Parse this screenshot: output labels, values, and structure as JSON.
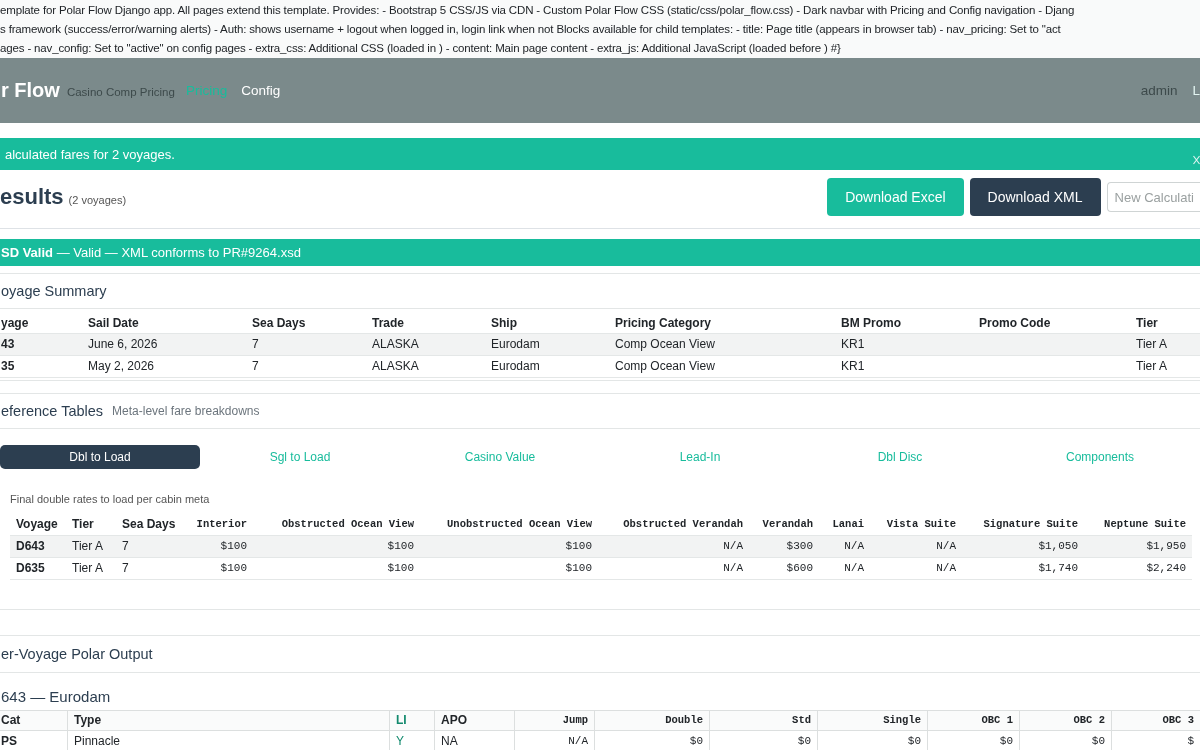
{
  "template_comment": {
    "lines": [
      "emplate for Polar Flow Django app. All pages extend this template. Provides: - Bootstrap 5 CSS/JS via CDN - Custom Polar Flow CSS (static/css/polar_flow.css) - Dark navbar with Pricing and Config navigation - Djang",
      "s framework (success/error/warning alerts) - Auth: shows username + logout when logged in, login link when not Blocks available for child templates: - title: Page title (appears in browser tab) - nav_pricing: Set to \"act",
      "ages - nav_config: Set to \"active\" on config pages - extra_css: Additional CSS (loaded in ) - content: Main page content - extra_js: Additional JavaScript (loaded before ) #}"
    ]
  },
  "navbar": {
    "brand": "r Flow",
    "subtitle": "Casino Comp Pricing",
    "links": [
      {
        "label": "Pricing",
        "selected": true
      },
      {
        "label": "Config",
        "selected": false
      }
    ],
    "user": "admin",
    "logout": "L"
  },
  "alert": {
    "message": "alculated fares for 2 voyages.",
    "dismissible": true
  },
  "results": {
    "title": "esults",
    "count": "(2 voyages)",
    "buttons": [
      {
        "label": "Download Excel",
        "kind": "success"
      },
      {
        "label": "Download XML",
        "kind": "primary"
      },
      {
        "label": "New Calculati",
        "kind": "outline"
      }
    ]
  },
  "validation": {
    "message": "**SD Valid** — Valid — XML conforms to PR#9264.xsd"
  },
  "voyage_summary": {
    "title": "oyage Summary",
    "columns": [
      {
        "label": "yage",
        "kind": "key"
      },
      {
        "label": "Sail Date",
        "kind": "text"
      },
      {
        "label": "Sea Days",
        "kind": "text"
      },
      {
        "label": "Trade",
        "kind": "text"
      },
      {
        "label": "Ship",
        "kind": "text"
      },
      {
        "label": "Pricing Category",
        "kind": "text"
      },
      {
        "label": "BM Promo",
        "kind": "text"
      },
      {
        "label": "Promo Code",
        "kind": "text"
      },
      {
        "label": "Tier",
        "kind": "text"
      }
    ],
    "rows": [
      [
        "43",
        "June 6, 2026",
        "7",
        "ALASKA",
        "Eurodam",
        "Comp Ocean View",
        "KR1",
        null,
        "Tier A"
      ],
      [
        "35",
        "May 2, 2026",
        "7",
        "ALASKA",
        "Eurodam",
        "Comp Ocean View",
        "KR1",
        null,
        "Tier A"
      ]
    ]
  },
  "reference_tables": {
    "title": "eference Tables",
    "subtitle": "Meta-level fare breakdowns",
    "tabs": [
      {
        "label": "Dbl to Load",
        "selected": true
      },
      {
        "label": "Sgl to Load",
        "selected": false
      },
      {
        "label": "Casino Value",
        "selected": false
      },
      {
        "label": "Lead-In",
        "selected": false
      },
      {
        "label": "Dbl Disc",
        "selected": false
      },
      {
        "label": "Components",
        "selected": false
      }
    ],
    "caption": "Final double rates to load per cabin meta",
    "columns": [
      {
        "label": "Voyage",
        "kind": "key"
      },
      {
        "label": "Tier",
        "kind": "text"
      },
      {
        "label": "Sea Days",
        "kind": "text"
      },
      {
        "label": "Interior",
        "kind": "number"
      },
      {
        "label": "Obstructed Ocean View",
        "kind": "number"
      },
      {
        "label": "Unobstructed Ocean View",
        "kind": "number"
      },
      {
        "label": "Obstructed Verandah",
        "kind": "number"
      },
      {
        "label": "Verandah",
        "kind": "number"
      },
      {
        "label": "Lanai",
        "kind": "number"
      },
      {
        "label": "Vista Suite",
        "kind": "number"
      },
      {
        "label": "Signature Suite",
        "kind": "number"
      },
      {
        "label": "Neptune Suite",
        "kind": "number"
      }
    ],
    "rows": [
      [
        "D643",
        "Tier A",
        "7",
        "$100",
        "$100",
        "$100",
        "N/A",
        "$300",
        "N/A",
        "N/A",
        "$1,050",
        "$1,950"
      ],
      [
        "D635",
        "Tier A",
        "7",
        "$100",
        "$100",
        "$100",
        "N/A",
        "$600",
        "N/A",
        "N/A",
        "$1,740",
        "$2,240"
      ]
    ]
  },
  "polar_output": {
    "title": "er-Voyage Polar Output",
    "voyages": [
      {
        "title": "643 — Eurodam",
        "columns": [
          {
            "label": "Cat",
            "kind": "key"
          },
          {
            "label": "Type",
            "kind": "text"
          },
          {
            "label": "LI",
            "kind": "flag"
          },
          {
            "label": "APO",
            "kind": "text"
          },
          {
            "label": "Jump",
            "kind": "number"
          },
          {
            "label": "Double",
            "kind": "number"
          },
          {
            "label": "Std",
            "kind": "number"
          },
          {
            "label": "Single",
            "kind": "number"
          },
          {
            "label": "OBC 1",
            "kind": "number"
          },
          {
            "label": "OBC 2",
            "kind": "number"
          },
          {
            "label": "OBC 3",
            "kind": "number"
          }
        ],
        "rows": [
          [
            "PS",
            "Pinnacle",
            "Y",
            "NA",
            "N/A",
            "$0",
            "$0",
            "$0",
            "$0",
            "$0",
            "$"
          ]
        ]
      }
    ]
  }
}
